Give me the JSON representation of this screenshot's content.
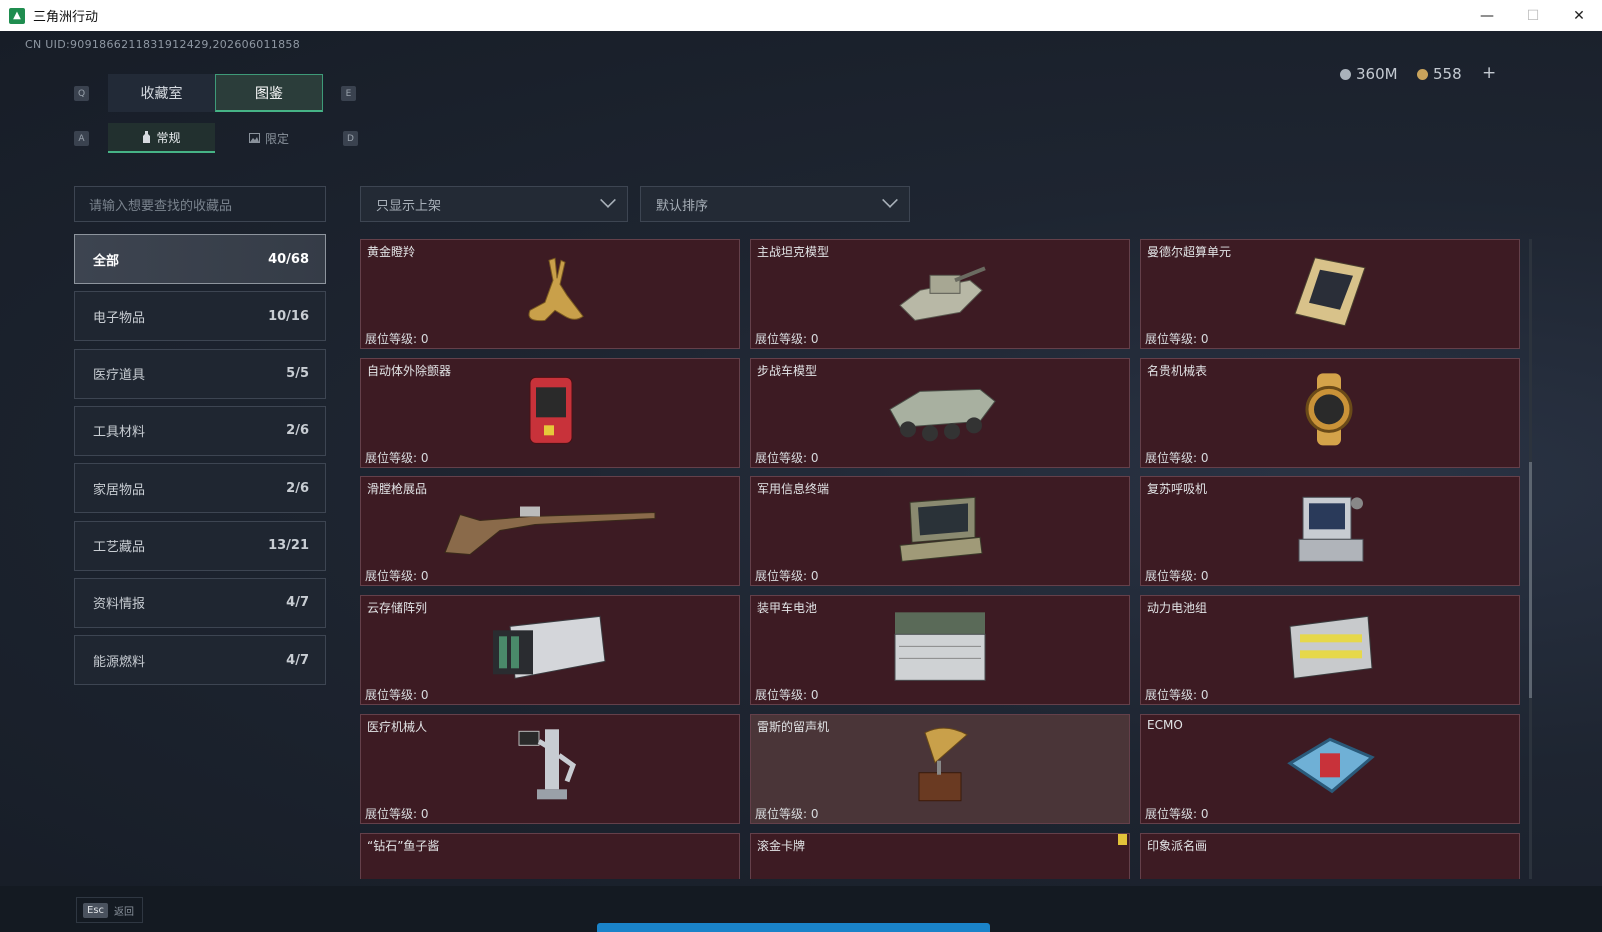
{
  "window": {
    "title": "三角洲行动",
    "minimize": "—",
    "maximize": "☐",
    "close": "✕"
  },
  "header": {
    "uid": "CN UID:9091866211831912429,202606011858",
    "currency1": {
      "value": "360M",
      "color": "#aab2bb"
    },
    "currency2": {
      "value": "558",
      "color": "#c9a35c"
    },
    "plus": "+"
  },
  "tabs": {
    "key_left": "Q",
    "key_right": "E",
    "items": [
      {
        "label": "收藏室",
        "active": false
      },
      {
        "label": "图鉴",
        "active": true
      }
    ]
  },
  "subtabs": {
    "key_left": "A",
    "key_right": "D",
    "items": [
      {
        "label": "常规",
        "active": true,
        "icon": "bottle-icon"
      },
      {
        "label": "限定",
        "active": false,
        "icon": "image-icon"
      }
    ]
  },
  "search": {
    "placeholder": "请输入想要查找的收藏品"
  },
  "filters": {
    "shelf": "只显示上架",
    "sort": "默认排序"
  },
  "categories": [
    {
      "label": "全部",
      "count": "40/68",
      "active": true
    },
    {
      "label": "电子物品",
      "count": "10/16",
      "active": false
    },
    {
      "label": "医疗道具",
      "count": "5/5",
      "active": false
    },
    {
      "label": "工具材料",
      "count": "2/6",
      "active": false
    },
    {
      "label": "家居物品",
      "count": "2/6",
      "active": false
    },
    {
      "label": "工艺藏品",
      "count": "13/21",
      "active": false
    },
    {
      "label": "资料情报",
      "count": "4/7",
      "active": false
    },
    {
      "label": "能源燃料",
      "count": "4/7",
      "active": false
    }
  ],
  "level_prefix": "展位等级: ",
  "items": [
    {
      "name": "黄金瞪羚",
      "level": "展位等级:  0",
      "icon": "gazelle-icon"
    },
    {
      "name": "主战坦克模型",
      "level": "展位等级:  0",
      "icon": "tank-icon"
    },
    {
      "name": "曼德尔超算单元",
      "level": "展位等级:  0",
      "icon": "chip-icon"
    },
    {
      "name": "自动体外除颤器",
      "level": "展位等级:  0",
      "icon": "defibrillator-icon"
    },
    {
      "name": "步战车模型",
      "level": "展位等级:  0",
      "icon": "ifv-icon"
    },
    {
      "name": "名贵机械表",
      "level": "展位等级:  0",
      "icon": "watch-icon"
    },
    {
      "name": "滑膛枪展品",
      "level": "展位等级:  0",
      "icon": "musket-icon"
    },
    {
      "name": "军用信息终端",
      "level": "展位等级:  0",
      "icon": "terminal-icon"
    },
    {
      "name": "复苏呼吸机",
      "level": "展位等级:  0",
      "icon": "ventilator-icon"
    },
    {
      "name": "云存储阵列",
      "level": "展位等级:  0",
      "icon": "storage-icon"
    },
    {
      "name": "装甲车电池",
      "level": "展位等级:  0",
      "icon": "battery-icon"
    },
    {
      "name": "动力电池组",
      "level": "展位等级:  0",
      "icon": "battery-pack-icon"
    },
    {
      "name": "医疗机械人",
      "level": "展位等级:  0",
      "icon": "robot-icon"
    },
    {
      "name": "雷斯的留声机",
      "level": "展位等级:  0",
      "icon": "gramophone-icon",
      "highlight": true
    },
    {
      "name": "ECMO",
      "level": "展位等级:  0",
      "icon": "ecmo-icon"
    },
    {
      "name": "“钻石”鱼子酱",
      "level": "",
      "icon": "caviar-icon"
    },
    {
      "name": "滚金卡牌",
      "level": "",
      "icon": "card-icon"
    },
    {
      "name": "印象派名画",
      "level": "",
      "icon": "painting-icon"
    }
  ],
  "footer": {
    "esc_key": "Esc",
    "esc_label": "返回"
  }
}
